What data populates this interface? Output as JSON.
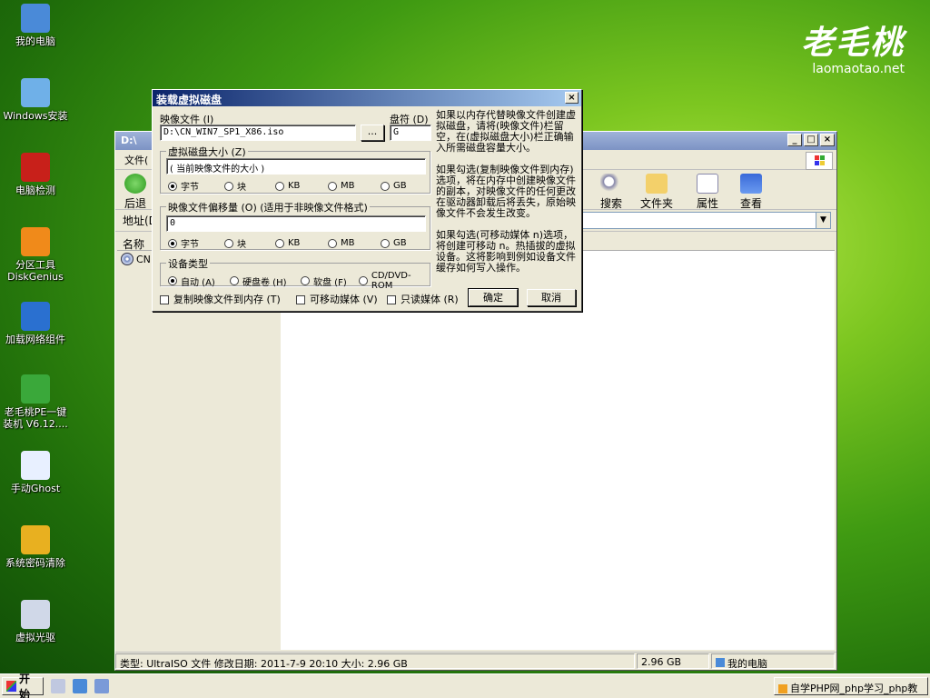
{
  "brand": {
    "logo": "老毛桃",
    "url": "laomaotao.net"
  },
  "desktop_icons": [
    {
      "label": "我的电脑",
      "icon": "computer-icon",
      "color": "#4a8ad8"
    },
    {
      "label": "Windows安装",
      "icon": "windows-install-icon",
      "color": "#6fb0e8"
    },
    {
      "label": "电脑检测",
      "icon": "aida64-icon",
      "color": "#c8201a"
    },
    {
      "label": "分区工具\nDiskGenius",
      "icon": "diskgenius-icon",
      "color": "#f08a1a"
    },
    {
      "label": "加载网络组件",
      "icon": "network-icon",
      "color": "#2a70d0"
    },
    {
      "label": "老毛桃PE一键\n装机 V6.12....",
      "icon": "laomaotao-icon",
      "color": "#3aa83a"
    },
    {
      "label": "手动Ghost",
      "icon": "ghost-icon",
      "color": "#e8f0ff"
    },
    {
      "label": "系统密码清除",
      "icon": "key-icon",
      "color": "#e8b020"
    },
    {
      "label": "虚拟光驱",
      "icon": "virtual-drive-icon",
      "color": "#d0d8e8"
    }
  ],
  "explorer": {
    "title": "D:\\",
    "menu_label": "文件(",
    "toolbar": {
      "back": "后退",
      "search": "搜索",
      "folders": "文件夹",
      "properties": "属性",
      "view": "查看"
    },
    "address_label": "地址(D",
    "column_name": "名称",
    "file_item": "CN",
    "status": {
      "info": "类型: UltraISO 文件 修改日期: 2011-7-9 20:10 大小: 2.96 GB",
      "size": "2.96 GB",
      "location": "我的电脑"
    }
  },
  "dialog": {
    "title": "装载虚拟磁盘",
    "image_file_label": "映像文件 (I)",
    "image_file_value": "D:\\CN_WIN7_SP1_X86.iso",
    "browse_label": "...",
    "drive_letter_label": "盘符 (D)",
    "drive_letter_value": "G",
    "disk_size_group": "虚拟磁盘大小 (Z)",
    "disk_size_value": "( 当前映像文件的大小 )",
    "units": [
      "字节",
      "块",
      "KB",
      "MB",
      "GB"
    ],
    "offset_group": "映像文件偏移量 (O) (适用于非映像文件格式)",
    "offset_value": "0",
    "device_type_group": "设备类型",
    "device_types": [
      "自动 (A)",
      "硬盘卷 (H)",
      "软盘 (F)",
      "CD/DVD-ROM"
    ],
    "copy_to_memory": "复制映像文件到内存 (T)",
    "removable": "可移动媒体 (V)",
    "readonly": "只读媒体 (R)",
    "ok_label": "确定",
    "cancel_label": "取消",
    "help": [
      "如果以内存代替映像文件创建虚拟磁盘，请将(映像文件)栏留空，在(虚拟磁盘大小)栏正确输入所需磁盘容量大小。",
      "如果勾选(复制映像文件到内存)选项，将在内存中创建映像文件的副本，对映像文件的任何更改在驱动器卸载后将丢失，原始映像文件不会发生改变。",
      "如果勾选(可移动媒体 n)选项，将创建可移动 n。热插拔的虚拟设备。这将影响到例如设备文件缓存如何写入操作。"
    ]
  },
  "taskbar": {
    "start_label": "开始",
    "task_item": "自学PHP网_php学习_php教"
  }
}
